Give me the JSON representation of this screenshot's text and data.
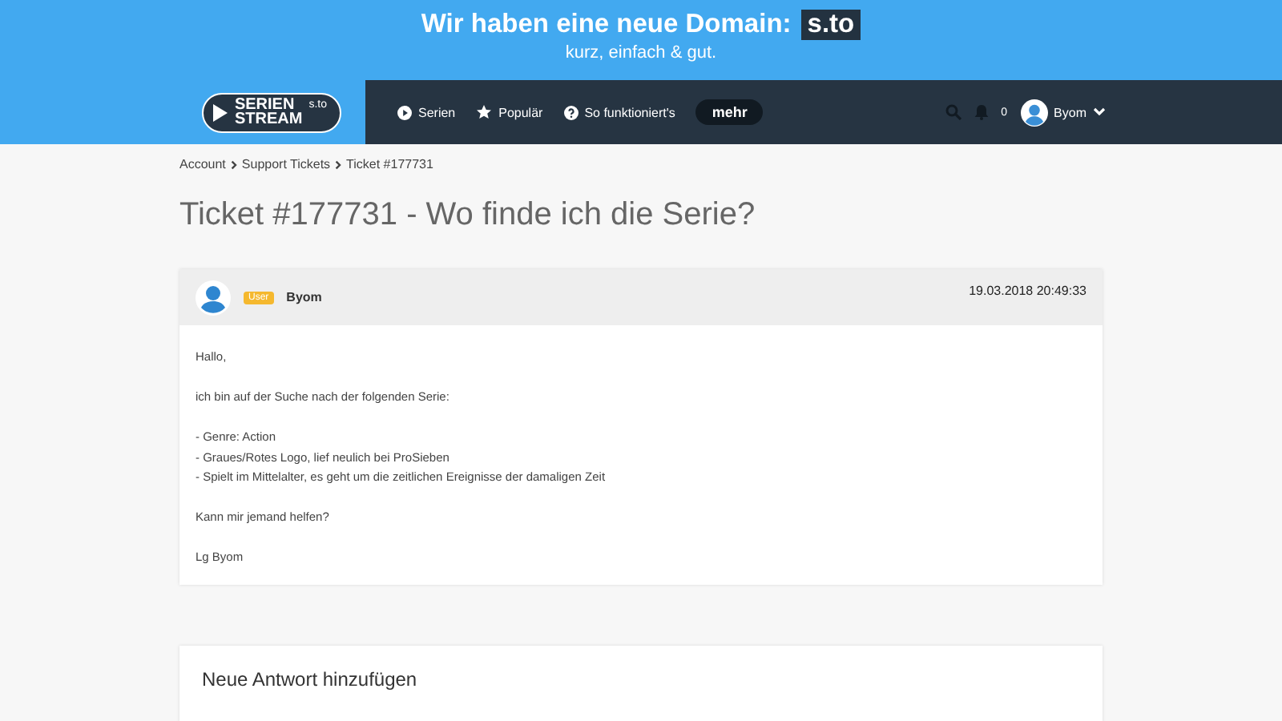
{
  "banner": {
    "headline": "Wir haben eine neue Domain:",
    "domain": "s.to",
    "tagline": "kurz, einfach & gut."
  },
  "nav": {
    "logo": {
      "line_1": "SERIEN",
      "line_2": "STREAM",
      "suffix": "s.to"
    },
    "links": [
      {
        "kind": "play",
        "label": "Serien"
      },
      {
        "kind": "star",
        "label": "Populär"
      },
      {
        "kind": "help",
        "label": "So funktioniert's"
      },
      {
        "kind": "pill",
        "label": "mehr"
      }
    ],
    "notifications": "0",
    "user": "Byom"
  },
  "breadcrumb": [
    "Account",
    "Support Tickets",
    "Ticket #177731"
  ],
  "title": "Ticket #177731 - Wo finde ich die Serie?",
  "post": {
    "role": "User",
    "author": "Byom",
    "date": "19.03.2018 20:49:33",
    "paragraphs": [
      [
        "Hallo,"
      ],
      [
        "ich bin auf der Suche nach der folgenden Serie:"
      ],
      [
        "- Genre: Action",
        "- Graues/Rotes Logo, lief neulich bei ProSieben",
        "- Spielt im Mittelalter, es geht um die zeitlichen Ereignisse der damaligen Zeit"
      ],
      [
        "Kann mir jemand helfen?"
      ],
      [
        "Lg Byom"
      ]
    ]
  },
  "reply": {
    "heading": "Neue Antwort hinzufügen"
  }
}
